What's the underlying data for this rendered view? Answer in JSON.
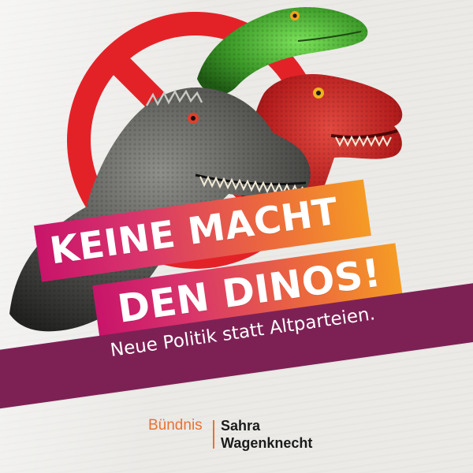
{
  "headline": {
    "line1": "KEINE MACHT",
    "line2": "DEN DINOS!"
  },
  "subline": "Neue Politik statt Altparteien.",
  "logo": {
    "part1": "Bündnis",
    "part2": "Sahra",
    "part3": "Wagenknecht"
  },
  "colors": {
    "headline_start": "#c8146a",
    "headline_end": "#f59b25",
    "band": "#7d2155",
    "logo_accent": "#e8722e",
    "prohibition_sign": "#e32228"
  },
  "illustration": {
    "prohibition_sign": "prohibition-sign-icon",
    "dinosaurs": [
      "green-dinosaur-head",
      "gray-dinosaur-head",
      "red-dinosaur-head"
    ]
  }
}
